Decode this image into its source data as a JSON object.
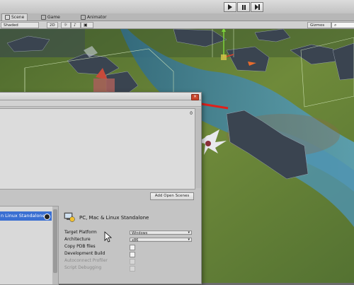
{
  "toolbar": {
    "play_icon": "play-icon",
    "pause_icon": "pause-icon",
    "step_icon": "step-icon"
  },
  "tabs": [
    {
      "label": "Scene",
      "icon": "scene-icon"
    },
    {
      "label": "Game",
      "icon": "game-icon"
    },
    {
      "label": "Animator",
      "icon": "animator-icon"
    }
  ],
  "scene_toolbar": {
    "shading": "Shaded",
    "mode_2d": "2D",
    "gizmos": "Gizmos"
  },
  "build_settings": {
    "scenes_count": "0",
    "add_open_scenes": "Add Open Scenes",
    "selected_platform": "PC, Mac & Linux Standalone",
    "platform_list_selected": "n Linux Standalone",
    "settings": {
      "target_platform_label": "Target Platform",
      "target_platform_value": "Windows",
      "architecture_label": "Architecture",
      "architecture_value": "x86",
      "copy_pdb_label": "Copy PDB files",
      "development_build_label": "Development Build",
      "autoconnect_profiler_label": "Autoconnect Profiler",
      "script_debugging_label": "Script Debugging"
    }
  },
  "colors": {
    "selection": "#3a6fd2",
    "close": "#c9452a",
    "water": "#3d7f9a",
    "grass": "#5b7a33"
  }
}
